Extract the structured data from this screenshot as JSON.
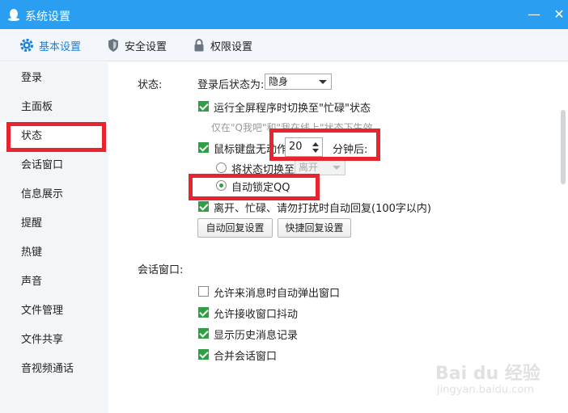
{
  "window": {
    "title": "系统设置",
    "minimize_glyph": "—",
    "close_glyph": "✕",
    "accent_color": "#2a9ef0"
  },
  "tabs": [
    {
      "label": "基本设置",
      "icon": "gear-icon",
      "active": true
    },
    {
      "label": "安全设置",
      "icon": "shield-icon",
      "active": false
    },
    {
      "label": "权限设置",
      "icon": "lock-icon",
      "active": false
    }
  ],
  "sidebar": {
    "items": [
      {
        "label": "登录"
      },
      {
        "label": "主面板"
      },
      {
        "label": "状态",
        "active": true
      },
      {
        "label": "会话窗口"
      },
      {
        "label": "信息展示"
      },
      {
        "label": "提醒"
      },
      {
        "label": "热键"
      },
      {
        "label": "声音"
      },
      {
        "label": "文件管理"
      },
      {
        "label": "文件共享"
      },
      {
        "label": "音视频通话"
      }
    ]
  },
  "status_section": {
    "heading": "状态:",
    "login_status_label": "登录后状态为:",
    "login_status_value": "隐身",
    "fullscreen_busy": {
      "label": "运行全屏程序时切换至\"忙碌\"状态",
      "checked": true
    },
    "fullscreen_hint": "仅在\"Q我吧\"和\"我在线上\"状态下生效。",
    "idle": {
      "label": "鼠标键盘无动作",
      "checked": true,
      "minutes": "20",
      "minutes_suffix": "分钟后:"
    },
    "switch_status": {
      "label": "将状态切换至",
      "checked": false,
      "value": "离开"
    },
    "auto_lock": {
      "label": "自动锁定QQ",
      "checked": true
    },
    "auto_reply": {
      "label": "离开、忙碌、请勿打扰时自动回复(100字以内)",
      "checked": true
    },
    "auto_reply_settings_button": "自动回复设置",
    "quick_reply_settings_button": "快捷回复设置"
  },
  "chat_section": {
    "heading": "会话窗口:",
    "options": [
      {
        "label": "允许来消息时自动弹出窗口",
        "checked": false
      },
      {
        "label": "允许接收窗口抖动",
        "checked": true
      },
      {
        "label": "显示历史消息记录",
        "checked": true
      },
      {
        "label": "合并会话窗口",
        "checked": true
      }
    ]
  },
  "watermark": {
    "main": "Bai du 经验",
    "sub": "jingyan.baidu.com"
  },
  "colors": {
    "highlight_box": "#e8242f",
    "checkbox_checked": "#2ea043",
    "active_tab": "#1a7fd6"
  }
}
